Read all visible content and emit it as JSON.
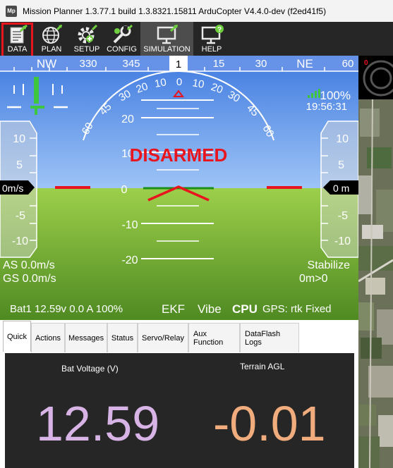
{
  "window": {
    "icon_text": "Mp",
    "title": "Mission Planner 1.3.77.1 build 1.3.8321.15811 ArduCopter V4.4.0-dev (f2ed41f5)"
  },
  "menu": [
    {
      "id": "data",
      "label": "DATA",
      "icon": "data-icon",
      "selected": true
    },
    {
      "id": "plan",
      "label": "PLAN",
      "icon": "globe-icon"
    },
    {
      "id": "setup",
      "label": "SETUP",
      "icon": "setup-icon"
    },
    {
      "id": "config",
      "label": "CONFIG",
      "icon": "config-icon"
    },
    {
      "id": "simulation",
      "label": "SIMULATION",
      "icon": "simulation-icon",
      "active": true
    },
    {
      "id": "help",
      "label": "HELP",
      "icon": "help-icon"
    }
  ],
  "hud": {
    "heading_tape": [
      "NW",
      "330",
      "345",
      "1",
      "15",
      "30",
      "NE",
      "60"
    ],
    "heading_value": "1",
    "roll_scale": [
      "60",
      "45",
      "30",
      "20",
      "10",
      "0",
      "10",
      "20",
      "30",
      "45",
      "60"
    ],
    "pitch_labels": [
      "20",
      "10",
      "0",
      "-10",
      "-20"
    ],
    "status_text": "DISARMED",
    "battery_percent_top": "100%",
    "clock": "19:56:31",
    "left_tape_labels": [
      "10",
      "5",
      "-5",
      "-10"
    ],
    "right_tape_labels": [
      "10",
      "5",
      "-5",
      "-10"
    ],
    "speed_readout": "0m/s",
    "alt_readout": "0 m",
    "airspeed": "AS 0.0m/s",
    "groundspeed": "GS 0.0m/s",
    "flight_mode": "Stabilize",
    "distance": "0m>0",
    "battery": "Bat1 12.59v 0.0 A 100%",
    "ekf": "EKF",
    "vibe": "Vibe",
    "cpu": "CPU",
    "gps": "GPS: rtk Fixed",
    "colors": {
      "sky": "#5b8de6",
      "ground": "#7cb53a",
      "disarmed": "#e8141e"
    }
  },
  "map": {
    "marker_label": "0"
  },
  "tabs": [
    {
      "label": "Quick",
      "selected": true
    },
    {
      "label": "Actions"
    },
    {
      "label": "Messages"
    },
    {
      "label": "Status"
    },
    {
      "label": "Servo/Relay"
    },
    {
      "label": "Aux Function"
    },
    {
      "label": "DataFlash Logs"
    }
  ],
  "quick": {
    "bat_voltage_label": "Bat Voltage (V)",
    "bat_voltage_value": "12.59",
    "terrain_agl_label": "Terrain AGL",
    "terrain_agl_value": "-0.01",
    "colors": {
      "bat_voltage": "#d8b4e6",
      "terrain_agl": "#f0ac7c"
    }
  }
}
